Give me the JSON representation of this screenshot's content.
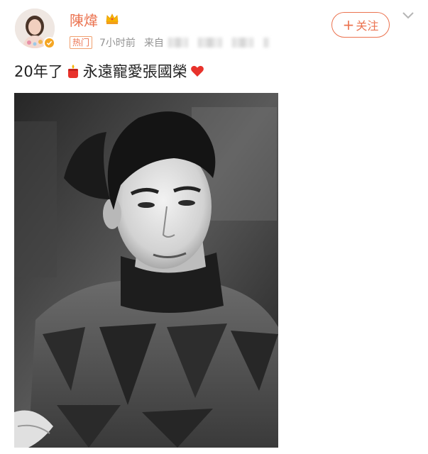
{
  "post": {
    "author": {
      "name": "陳煒",
      "verified_color": "#f5a623",
      "name_color": "#eb7350",
      "badge_icon": "crown-icon"
    },
    "meta": {
      "hot_badge": "热门",
      "time": "7小时前",
      "source_prefix": "来自"
    },
    "follow_button": {
      "plus": "+",
      "label": "关注"
    },
    "menu_icon": "chevron-down-icon",
    "text": {
      "part1": "20年了",
      "icon1": "candle-icon",
      "part2": "永遠寵愛張國榮",
      "icon2": "red-heart-icon"
    },
    "photo": {
      "description_icon": "photo-image"
    }
  }
}
